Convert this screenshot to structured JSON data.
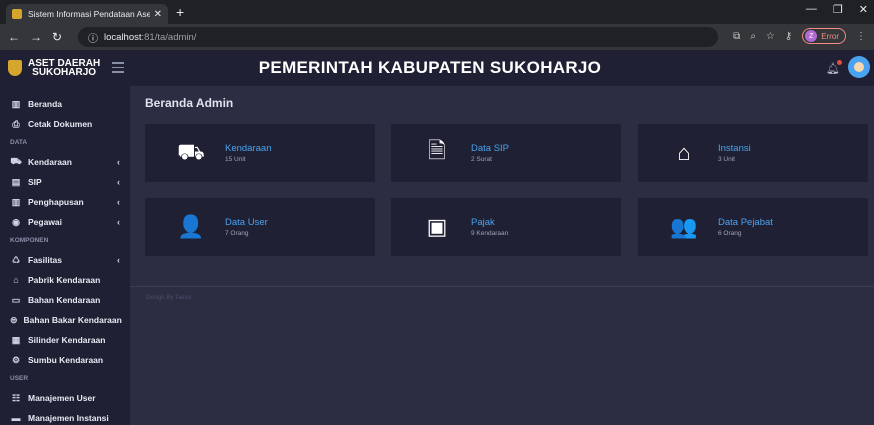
{
  "browser": {
    "tab_title": "Sistem Informasi Pendataan Aset",
    "url_host": "localhost",
    "url_path": ":81/ta/admin/",
    "profile_initial": "Z",
    "error_label": "Error"
  },
  "header": {
    "brand_line1": "ASET DAERAH",
    "brand_line2": "SUKOHARJO",
    "title": "PEMERINTAH KABUPATEN SUKOHARJO"
  },
  "sidebar": {
    "items": [
      {
        "type": "item",
        "label": "Beranda",
        "icon": "dashboard-icon",
        "glyph": "▥",
        "arrow": false
      },
      {
        "type": "item",
        "label": "Cetak Dokumen",
        "icon": "print-icon",
        "glyph": "⎙",
        "arrow": false
      },
      {
        "type": "section",
        "label": "DATA"
      },
      {
        "type": "item",
        "label": "Kendaraan",
        "icon": "car-icon",
        "glyph": "⛟",
        "arrow": true
      },
      {
        "type": "item",
        "label": "SIP",
        "icon": "file-icon",
        "glyph": "▤",
        "arrow": true
      },
      {
        "type": "item",
        "label": "Penghapusan",
        "icon": "trash-icon",
        "glyph": "▥",
        "arrow": true
      },
      {
        "type": "item",
        "label": "Pegawai",
        "icon": "user-circle-icon",
        "glyph": "◉",
        "arrow": true
      },
      {
        "type": "section",
        "label": "KOMPONEN"
      },
      {
        "type": "item",
        "label": "Fasilitas",
        "icon": "recycle-icon",
        "glyph": "♺",
        "arrow": true
      },
      {
        "type": "item",
        "label": "Pabrik Kendaraan",
        "icon": "factory-icon",
        "glyph": "⌂",
        "arrow": false
      },
      {
        "type": "item",
        "label": "Bahan Kendaraan",
        "icon": "box-icon",
        "glyph": "▭",
        "arrow": false
      },
      {
        "type": "item",
        "label": "Bahan Bakar Kendaraan",
        "icon": "fuel-icon",
        "glyph": "⊜",
        "arrow": false
      },
      {
        "type": "item",
        "label": "Silinder Kendaraan",
        "icon": "cylinder-icon",
        "glyph": "▦",
        "arrow": false
      },
      {
        "type": "item",
        "label": "Sumbu Kendaraan",
        "icon": "axle-icon",
        "glyph": "⚙",
        "arrow": false
      },
      {
        "type": "section",
        "label": "USER"
      },
      {
        "type": "item",
        "label": "Manajemen User",
        "icon": "users-icon",
        "glyph": "☷",
        "arrow": false
      },
      {
        "type": "item",
        "label": "Manajemen Instansi",
        "icon": "building-icon",
        "glyph": "▬",
        "arrow": false
      }
    ]
  },
  "main": {
    "page_title": "Beranda Admin",
    "cards": [
      {
        "title": "Kendaraan",
        "subtitle": "15 Unit",
        "icon": "car-icon",
        "glyph": "⛟"
      },
      {
        "title": "Data SIP",
        "subtitle": "2 Surat",
        "icon": "document-icon",
        "glyph": "🗎"
      },
      {
        "title": "Instansi",
        "subtitle": "3 Unit",
        "icon": "home-icon",
        "glyph": "⌂"
      },
      {
        "title": "Data User",
        "subtitle": "7 Orang",
        "icon": "user-icon",
        "glyph": "👤"
      },
      {
        "title": "Pajak",
        "subtitle": "9 Kendaraan",
        "icon": "money-icon",
        "glyph": "▣"
      },
      {
        "title": "Data Pejabat",
        "subtitle": "6 Orang",
        "icon": "users-icon",
        "glyph": "👥"
      }
    ],
    "footer": "Design By Taeva"
  }
}
